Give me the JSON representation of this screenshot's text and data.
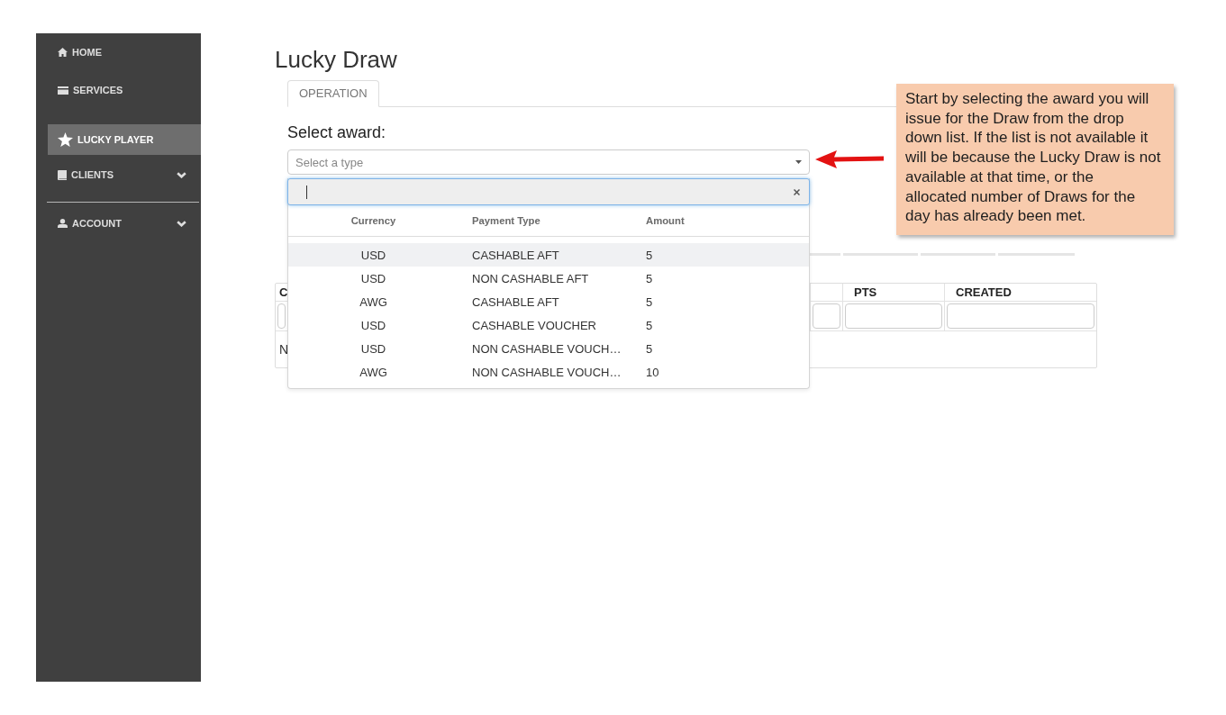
{
  "sidebar": {
    "items": [
      {
        "label": "HOME",
        "kind": "link",
        "selected": false
      },
      {
        "label": "SERVICES",
        "kind": "link",
        "selected": false
      },
      {
        "label": "LUCKY PLAYER",
        "kind": "link",
        "selected": true
      },
      {
        "label": "CLIENTS",
        "kind": "group",
        "selected": false,
        "expanded": false
      },
      {
        "label": "ACCOUNT",
        "kind": "group",
        "selected": false,
        "expanded": false
      }
    ]
  },
  "page": {
    "title": "Lucky Draw"
  },
  "tabs": [
    {
      "label": "OPERATION",
      "selected": true
    }
  ],
  "award_select": {
    "label": "Select award:",
    "placeholder": "Select a type",
    "open": true
  },
  "dropdown": {
    "search": {
      "focused": true
    },
    "columns": [
      "Currency",
      "Payment Type",
      "Amount"
    ],
    "options": [
      {
        "currency": "USD",
        "payment_type": "CASHABLE AFT",
        "amount": "5",
        "selected": true
      },
      {
        "currency": "USD",
        "payment_type": "NON CASHABLE AFT",
        "amount": "5",
        "selected": false
      },
      {
        "currency": "AWG",
        "payment_type": "CASHABLE AFT",
        "amount": "5",
        "selected": false
      },
      {
        "currency": "USD",
        "payment_type": "CASHABLE VOUCHER",
        "amount": "5",
        "selected": false
      },
      {
        "currency": "USD",
        "payment_type": "NON CASHABLE VOUCH…",
        "amount": "5",
        "selected": false
      },
      {
        "currency": "AWG",
        "payment_type": "NON CASHABLE VOUCH…",
        "amount": "10",
        "selected": false
      }
    ]
  },
  "table": {
    "columns": [
      {
        "label": "C"
      },
      {
        "label": "PTS"
      },
      {
        "label": "CREATED"
      }
    ],
    "body_text": "N"
  },
  "callout": {
    "lines": [
      "Start by selecting the award you will",
      "issue for the Draw from the drop",
      "down list. If the list is not available it",
      "will be because the Lucky Draw is not",
      "available at that time, or the",
      "allocated number of Draws for the",
      "day has already been met."
    ]
  }
}
